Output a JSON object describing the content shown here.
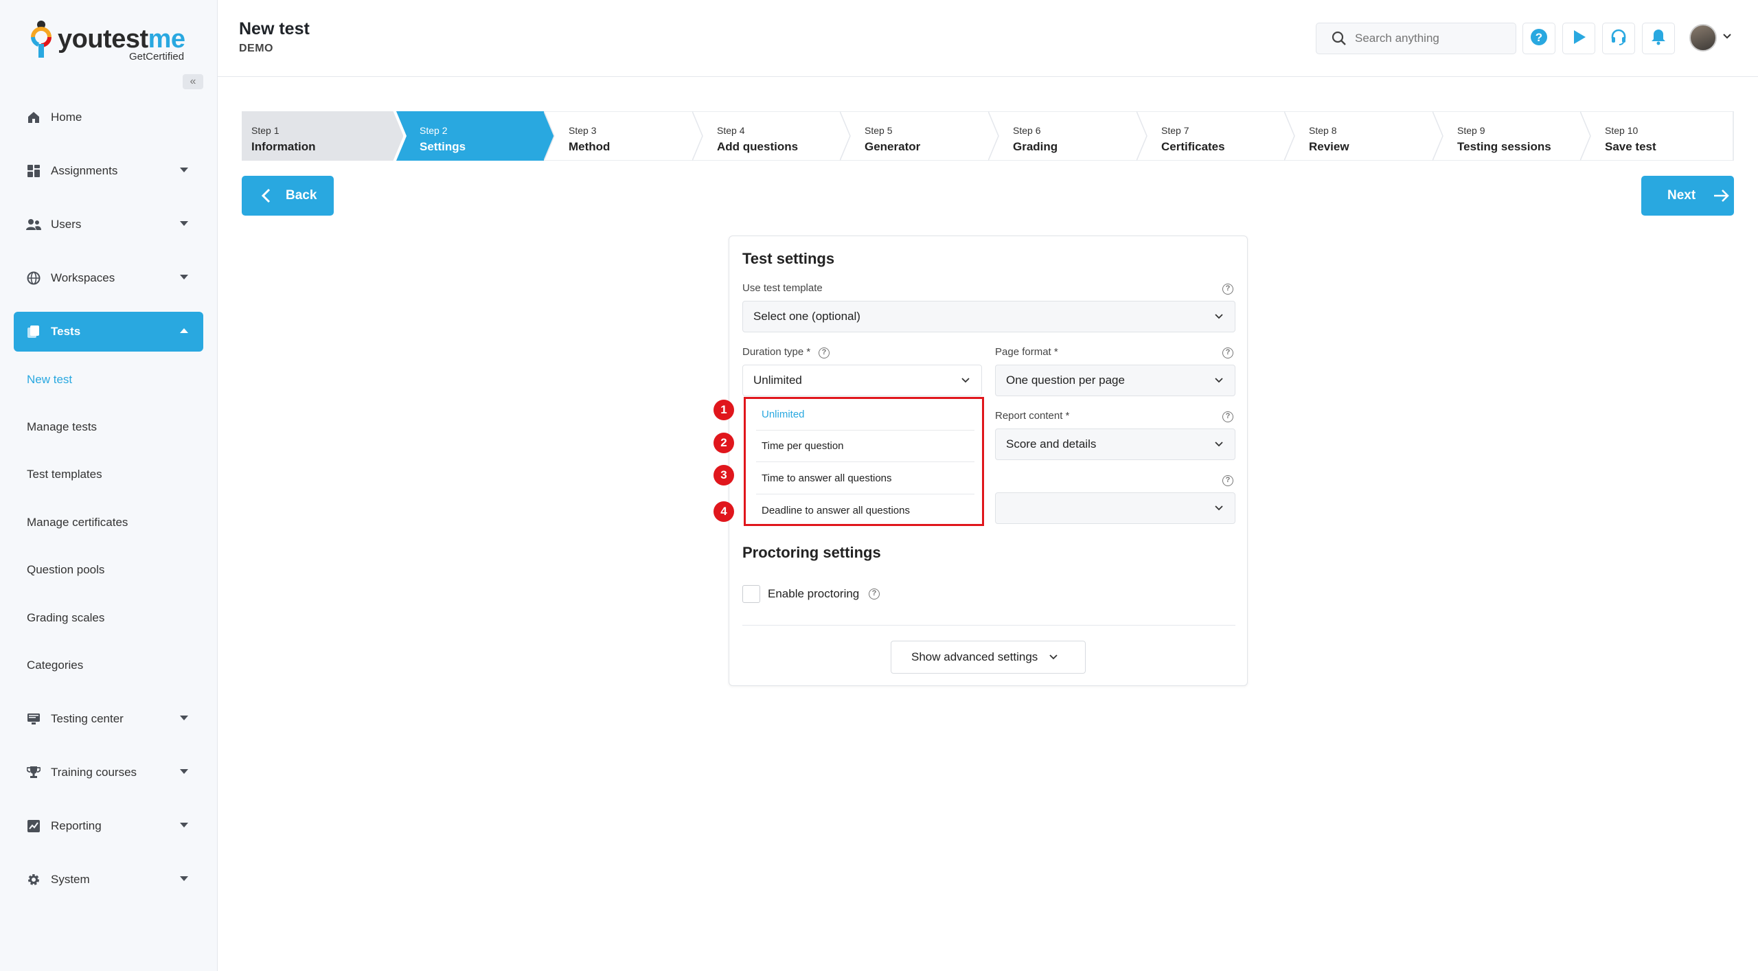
{
  "brand": {
    "name_main": "youtest",
    "name_accent": "me",
    "tagline": "GetCertified",
    "colors": {
      "accent": "#29a8e0",
      "highlight": "#e0161c"
    }
  },
  "sidebar": {
    "collapse_icon": "double-chevron-left-icon",
    "items": [
      {
        "label": "Home",
        "icon": "home-icon",
        "expandable": false
      },
      {
        "label": "Assignments",
        "icon": "assignments-icon",
        "expandable": true
      },
      {
        "label": "Users",
        "icon": "users-icon",
        "expandable": true
      },
      {
        "label": "Workspaces",
        "icon": "globe-icon",
        "expandable": true
      },
      {
        "label": "Tests",
        "icon": "tests-icon",
        "expandable": true,
        "active": true
      },
      {
        "label": "Testing center",
        "icon": "monitor-icon",
        "expandable": true
      },
      {
        "label": "Training courses",
        "icon": "trophy-icon",
        "expandable": true
      },
      {
        "label": "Reporting",
        "icon": "chart-icon",
        "expandable": true
      },
      {
        "label": "System",
        "icon": "gear-icon",
        "expandable": true
      }
    ],
    "tests_sub": [
      "New test",
      "Manage tests",
      "Test templates",
      "Manage certificates",
      "Question pools",
      "Grading scales",
      "Categories"
    ]
  },
  "header": {
    "title": "New test",
    "subtitle": "DEMO",
    "search_placeholder": "Search anything"
  },
  "steps": [
    {
      "num": "Step 1",
      "label": "Information",
      "state": "done"
    },
    {
      "num": "Step 2",
      "label": "Settings",
      "state": "active"
    },
    {
      "num": "Step 3",
      "label": "Method",
      "state": "todo"
    },
    {
      "num": "Step 4",
      "label": "Add questions",
      "state": "todo"
    },
    {
      "num": "Step 5",
      "label": "Generator",
      "state": "todo"
    },
    {
      "num": "Step 6",
      "label": "Grading",
      "state": "todo"
    },
    {
      "num": "Step 7",
      "label": "Certificates",
      "state": "todo"
    },
    {
      "num": "Step 8",
      "label": "Review",
      "state": "todo"
    },
    {
      "num": "Step 9",
      "label": "Testing sessions",
      "state": "todo"
    },
    {
      "num": "Step 10",
      "label": "Save test",
      "state": "todo"
    }
  ],
  "nav_buttons": {
    "back": "Back",
    "next": "Next"
  },
  "test_settings": {
    "title": "Test settings",
    "template_label": "Use test template",
    "template_value": "Select one (optional)",
    "duration_label": "Duration type *",
    "duration_value": "Unlimited",
    "page_format_label": "Page format *",
    "page_format_value": "One question per page",
    "report_label": "Report content *",
    "report_value": "Score and details",
    "duration_options": [
      "Unlimited",
      "Time per question",
      "Time to answer all questions",
      "Deadline to answer all questions"
    ],
    "markers": [
      "1",
      "2",
      "3",
      "4"
    ]
  },
  "proctoring": {
    "title": "Proctoring settings",
    "enable_label": "Enable proctoring",
    "advanced_button": "Show advanced settings"
  }
}
